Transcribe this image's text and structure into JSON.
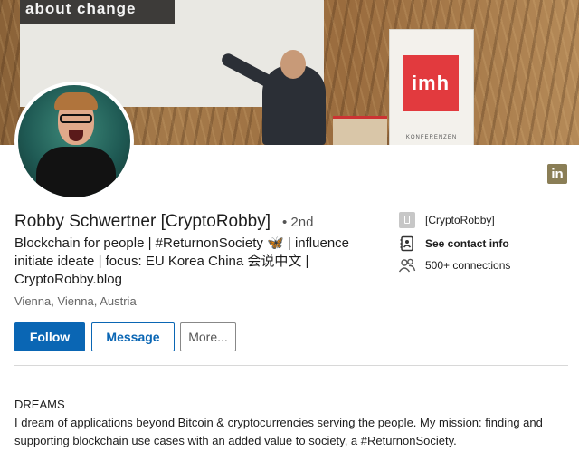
{
  "banner": {
    "screen_text": "about change",
    "stand_logo": "imh",
    "stand_sub": "KONFERENZEN"
  },
  "profile": {
    "name": "Robby Schwertner [CryptoRobby]",
    "degree": "• 2nd",
    "headline": "Blockchain for people | #ReturnonSociety 🦋 | influence initiate ideate | focus: EU Korea China 会说中文 | CryptoRobby.blog",
    "location": "Vienna, Vienna, Austria"
  },
  "actions": {
    "follow": "Follow",
    "message": "Message",
    "more": "More..."
  },
  "contact": {
    "twitter": "[CryptoRobby]",
    "contact_info": "See contact info",
    "connections": "500+ connections"
  },
  "about": {
    "title": "DREAMS",
    "text": "I dream of applications beyond Bitcoin & cryptocurrencies serving the people. My mission: finding and supporting blockchain use cases with an added value to society, a #ReturnonSociety."
  },
  "linkedin_badge": "in",
  "colors": {
    "accent": "#0a66b4",
    "linkedin_badge": "#8a7e56"
  }
}
